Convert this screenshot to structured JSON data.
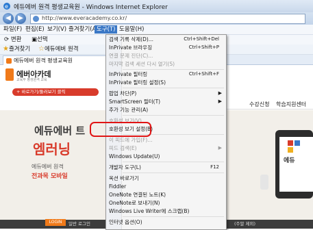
{
  "window": {
    "title": "에듀에버 원격 평생교육원 - Windows Internet Explorer"
  },
  "address": {
    "url": "http://www.everacademy.co.kr/"
  },
  "menubar": [
    "파일(F)",
    "편집(E)",
    "보기(V)",
    "즐겨찾기(A)",
    "도구(T)",
    "도움말(H)"
  ],
  "toolbar": {
    "convert": "변환",
    "select": "선택",
    "favorites": "즐겨찾기",
    "fav_item": "에듀에버 원격"
  },
  "tab": {
    "label": "에듀에버 원격 평생교육원"
  },
  "page": {
    "logo_text": "에버아카데",
    "logo_sub": "교육부 평생원격 교육",
    "banner": "+ 바로가기/둘러보기 클릭",
    "nav_right_1": "수강신청",
    "nav_right_2": "학습지원센터",
    "hero_line1": "에듀에버 트",
    "hero_line2": "엠러닝",
    "hero_line3": "에듀에버 원격",
    "hero_line4": "전과목 모바일",
    "device_label": "에듀",
    "login_label": "LOGIN",
    "footer_text": "일반 로그인",
    "footer_right": "(주말 제외)"
  },
  "dropdown": {
    "items": [
      {
        "label": "검색 기록 삭제(D)...",
        "shortcut": "Ctrl+Shift+Del",
        "disabled": false
      },
      {
        "label": "InPrivate 브라우징",
        "shortcut": "Ctrl+Shift+P",
        "disabled": false
      },
      {
        "label": "연결 문제 진단(C)...",
        "shortcut": "",
        "disabled": true
      },
      {
        "label": "마지막 검색 세션 다시 열기(S)",
        "shortcut": "",
        "disabled": true
      },
      {
        "label": "InPrivate 필터링",
        "shortcut": "Ctrl+Shift+F",
        "disabled": false
      },
      {
        "label": "InPrivate 필터링 설정(S)",
        "shortcut": "",
        "disabled": false
      },
      {
        "label": "팝업 차단(P)",
        "shortcut": "",
        "disabled": false,
        "submenu": true
      },
      {
        "label": "SmartScreen 필터(T)",
        "shortcut": "",
        "disabled": false,
        "submenu": true
      },
      {
        "label": "추가 기능 관리(A)",
        "shortcut": "",
        "disabled": false
      },
      {
        "label": "호환성 보기(V)",
        "shortcut": "",
        "disabled": true
      },
      {
        "label": "호환성 보기 설정(B)",
        "shortcut": "",
        "disabled": false
      },
      {
        "label": "이 피드에 가입(F)...",
        "shortcut": "",
        "disabled": true
      },
      {
        "label": "피드 검색(E)",
        "shortcut": "",
        "disabled": true,
        "submenu": true
      },
      {
        "label": "Windows Update(U)",
        "shortcut": "",
        "disabled": false
      },
      {
        "label": "개발자 도구(L)",
        "shortcut": "F12",
        "disabled": false
      },
      {
        "label": "옥션 바로가기",
        "shortcut": "",
        "disabled": false
      },
      {
        "label": "Fiddler",
        "shortcut": "",
        "disabled": false
      },
      {
        "label": "OneNote 연결된 노트(K)",
        "shortcut": "",
        "disabled": false
      },
      {
        "label": "OneNote로 보내기(N)",
        "shortcut": "",
        "disabled": false
      },
      {
        "label": "Windows Live Writer에 스크랩(B)",
        "shortcut": "",
        "disabled": false
      },
      {
        "label": "인터넷 옵션(O)",
        "shortcut": "",
        "disabled": false
      }
    ],
    "highlighted_index": 10
  },
  "colors": {
    "menu_active": "#3b78c6",
    "highlight_ring": "#e01414",
    "brand": "#f07a1a"
  },
  "icons": [
    "ie-logo-icon",
    "back-icon",
    "forward-icon",
    "favicon-icon",
    "star-icon",
    "tab-favicon-icon",
    "submenu-arrow-icon"
  ]
}
